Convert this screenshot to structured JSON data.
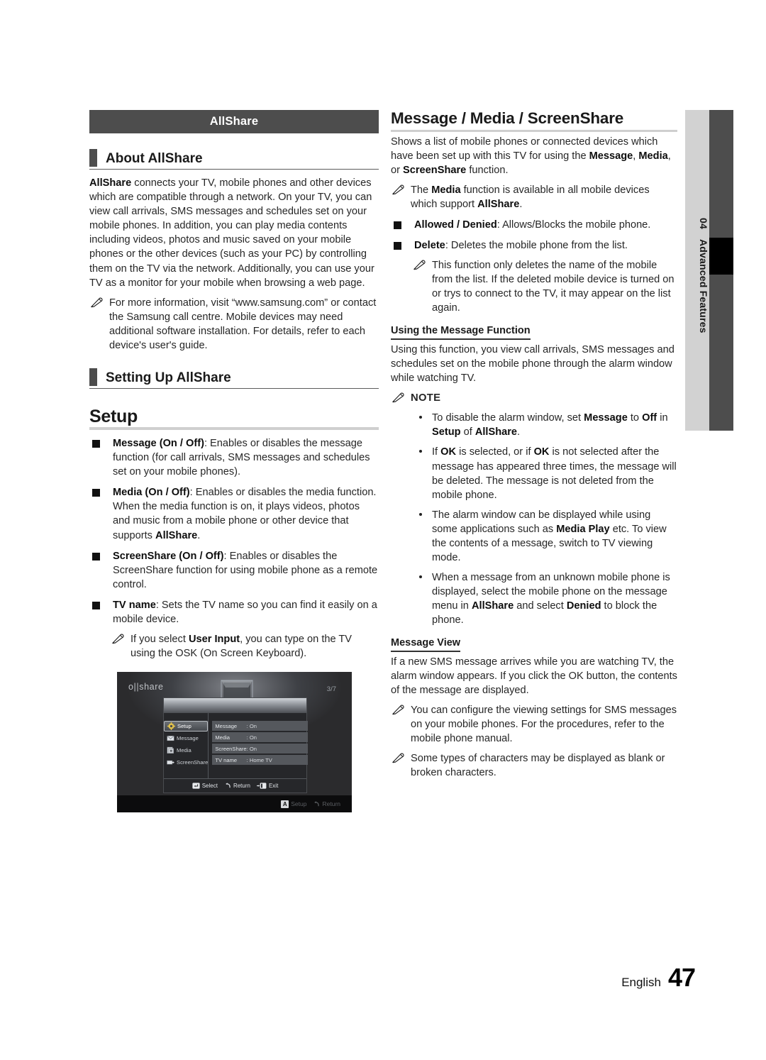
{
  "left_column": {
    "titlebar": "AllShare",
    "section_about": {
      "heading": "About AllShare",
      "paragraph": "AllShare connects your TV, mobile phones and other devices which are compatible through a network. On your TV, you can view call arrivals, SMS messages and schedules set on your mobile phones. In addition, you can play media contents including videos, photos and music saved on your mobile phones or the other devices (such as your PC) by controlling them on the TV via the network. Additionally, you can use your TV as a monitor for your mobile when browsing a web page.",
      "note": "For more information, visit “www.samsung.com” or contact the Samsung call centre. Mobile devices may need additional software installation. For details, refer to each device's user's guide."
    },
    "section_setting_up": {
      "heading": "Setting Up AllShare"
    },
    "setup": {
      "heading": "Setup",
      "items": [
        {
          "term": "Message (On / Off)",
          "text": ": Enables or disables the message function (for call arrivals, SMS messages and schedules set on your mobile phones)."
        },
        {
          "term": "Media (On / Off)",
          "text": ": Enables or disables the media function. When the media function is on, it plays videos, photos and music from a mobile phone or other device that supports ",
          "term_end": "AllShare",
          "text_end": "."
        },
        {
          "term": "ScreenShare (On / Off)",
          "text": ": Enables or disables the ScreenShare function for using mobile phone as a remote control."
        },
        {
          "term": "TV name",
          "text": ": Sets the TV name so you can find it easily on a mobile device."
        }
      ],
      "note_pre": "If you select ",
      "note_bold": "User Input",
      "note_post": ", you can type on the TV using the OSK (On Screen Keyboard)."
    },
    "tv_screenshot": {
      "logo": "o||share",
      "page_indicator": "3/7",
      "nav_items": [
        {
          "label": "Setup",
          "icon": "gear-icon",
          "selected": true
        },
        {
          "label": "Message",
          "icon": "envelope-icon",
          "selected": false
        },
        {
          "label": "Media",
          "icon": "media-icon",
          "selected": false
        },
        {
          "label": "ScreenShare",
          "icon": "screenshare-icon",
          "selected": false
        }
      ],
      "rows": [
        {
          "label": "Message",
          "value": ": On"
        },
        {
          "label": "Media",
          "value": ": On"
        },
        {
          "label": "ScreenShare",
          "value": ": On"
        },
        {
          "label": "TV name",
          "value": ": Home TV"
        }
      ],
      "footer_actions": [
        {
          "label": "Select",
          "icon": "enter-key-icon"
        },
        {
          "label": "Return",
          "icon": "return-arrow-icon"
        },
        {
          "label": "Exit",
          "icon": "exit-key-icon"
        }
      ],
      "black_bar": [
        {
          "label": "Setup",
          "key": "A"
        },
        {
          "label": "Return",
          "key": ""
        }
      ]
    }
  },
  "right_column": {
    "heading": "Message / Media / ScreenShare",
    "intro_1": "Shows a list of mobile phones or connected devices which have been set up with this TV for using the ",
    "intro_b1": "Message",
    "intro_2": ", ",
    "intro_b2": "Media",
    "intro_3": ", or ",
    "intro_b3": "ScreenShare",
    "intro_4": " function.",
    "note_media_1": "The ",
    "note_media_b1": "Media",
    "note_media_2": " function is available in all mobile devices which support ",
    "note_media_b2": "AllShare",
    "note_media_3": ".",
    "bullets": [
      {
        "term": "Allowed / Denied",
        "text": ": Allows/Blocks the mobile phone."
      },
      {
        "term": "Delete",
        "text": ": Deletes the mobile phone from the list."
      }
    ],
    "delete_note": "This function only deletes the name of the mobile from the list. If the deleted mobile device is turned on or trys to connect to the TV, it may appear on the list again.",
    "using_message": {
      "heading": "Using the Message Function",
      "paragraph": "Using this function, you view call arrivals, SMS messages and schedules set on the mobile phone through the alarm window while watching TV.",
      "note_label": "NOTE",
      "notes": [
        {
          "parts": [
            {
              "t": "To disable the alarm window, set ",
              "b": false
            },
            {
              "t": "Message",
              "b": true
            },
            {
              "t": " to ",
              "b": false
            },
            {
              "t": "Off",
              "b": true
            },
            {
              "t": " in ",
              "b": false
            },
            {
              "t": "Setup",
              "b": true
            },
            {
              "t": " of ",
              "b": false
            },
            {
              "t": "AllShare",
              "b": true
            },
            {
              "t": ".",
              "b": false
            }
          ]
        },
        {
          "parts": [
            {
              "t": "If ",
              "b": false
            },
            {
              "t": "OK",
              "b": true
            },
            {
              "t": " is selected, or if ",
              "b": false
            },
            {
              "t": "OK",
              "b": true
            },
            {
              "t": " is not selected after the message has appeared three times, the message will be deleted. The message is not deleted from the mobile phone.",
              "b": false
            }
          ]
        },
        {
          "parts": [
            {
              "t": "The alarm window can be displayed while using some applications such as ",
              "b": false
            },
            {
              "t": "Media Play",
              "b": true
            },
            {
              "t": " etc. To view the contents of a message, switch to TV viewing mode.",
              "b": false
            }
          ]
        },
        {
          "parts": [
            {
              "t": "When a message from an unknown mobile phone is displayed, select the mobile phone on the message menu in ",
              "b": false
            },
            {
              "t": "AllShare",
              "b": true
            },
            {
              "t": " and select ",
              "b": false
            },
            {
              "t": "Denied",
              "b": true
            },
            {
              "t": " to block the phone.",
              "b": false
            }
          ]
        }
      ]
    },
    "message_view": {
      "heading": "Message View",
      "paragraph": "If a new SMS message arrives while you are watching TV, the alarm window appears. If you click the OK button, the contents of the message are displayed.",
      "note_1": "You can configure the viewing settings for SMS messages on your mobile phones. For the procedures, refer to the mobile phone manual.",
      "note_2": "Some types of characters may be displayed as blank or broken characters."
    }
  },
  "side_tab": {
    "number": "04",
    "label": "Advanced Features"
  },
  "footer": {
    "language": "English",
    "page_number": "47"
  },
  "colors": {
    "titlebar_bg": "#4d4d4d",
    "marker": "#4d4d4d",
    "rule_light": "#cfcfcf",
    "sidetab_light": "#d2d2d2",
    "sidetab_dark": "#4d4d4d"
  }
}
